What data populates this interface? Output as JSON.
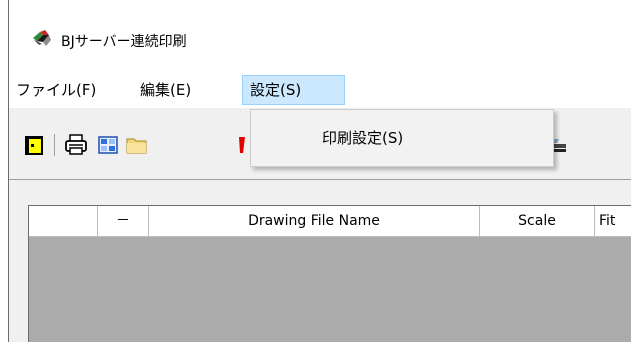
{
  "window": {
    "title": "BJサーバー連続印刷"
  },
  "menubar": {
    "items": [
      {
        "label": "ファイル(F)"
      },
      {
        "label": "編集(E)"
      },
      {
        "label": "設定(S)"
      }
    ]
  },
  "dropdown": {
    "items": [
      {
        "label": "印刷設定(S)"
      }
    ]
  },
  "toolbar": {
    "buttons": [
      "new-icon",
      "print-icon",
      "grid-icon",
      "folder-icon",
      "red-icon",
      "printer-icon"
    ]
  },
  "grid": {
    "columns": [
      "",
      "－",
      "Drawing File Name",
      "Scale",
      "Fit"
    ]
  },
  "colors": {
    "menu_highlight": "#cce8ff",
    "grid_background": "#ababab"
  }
}
